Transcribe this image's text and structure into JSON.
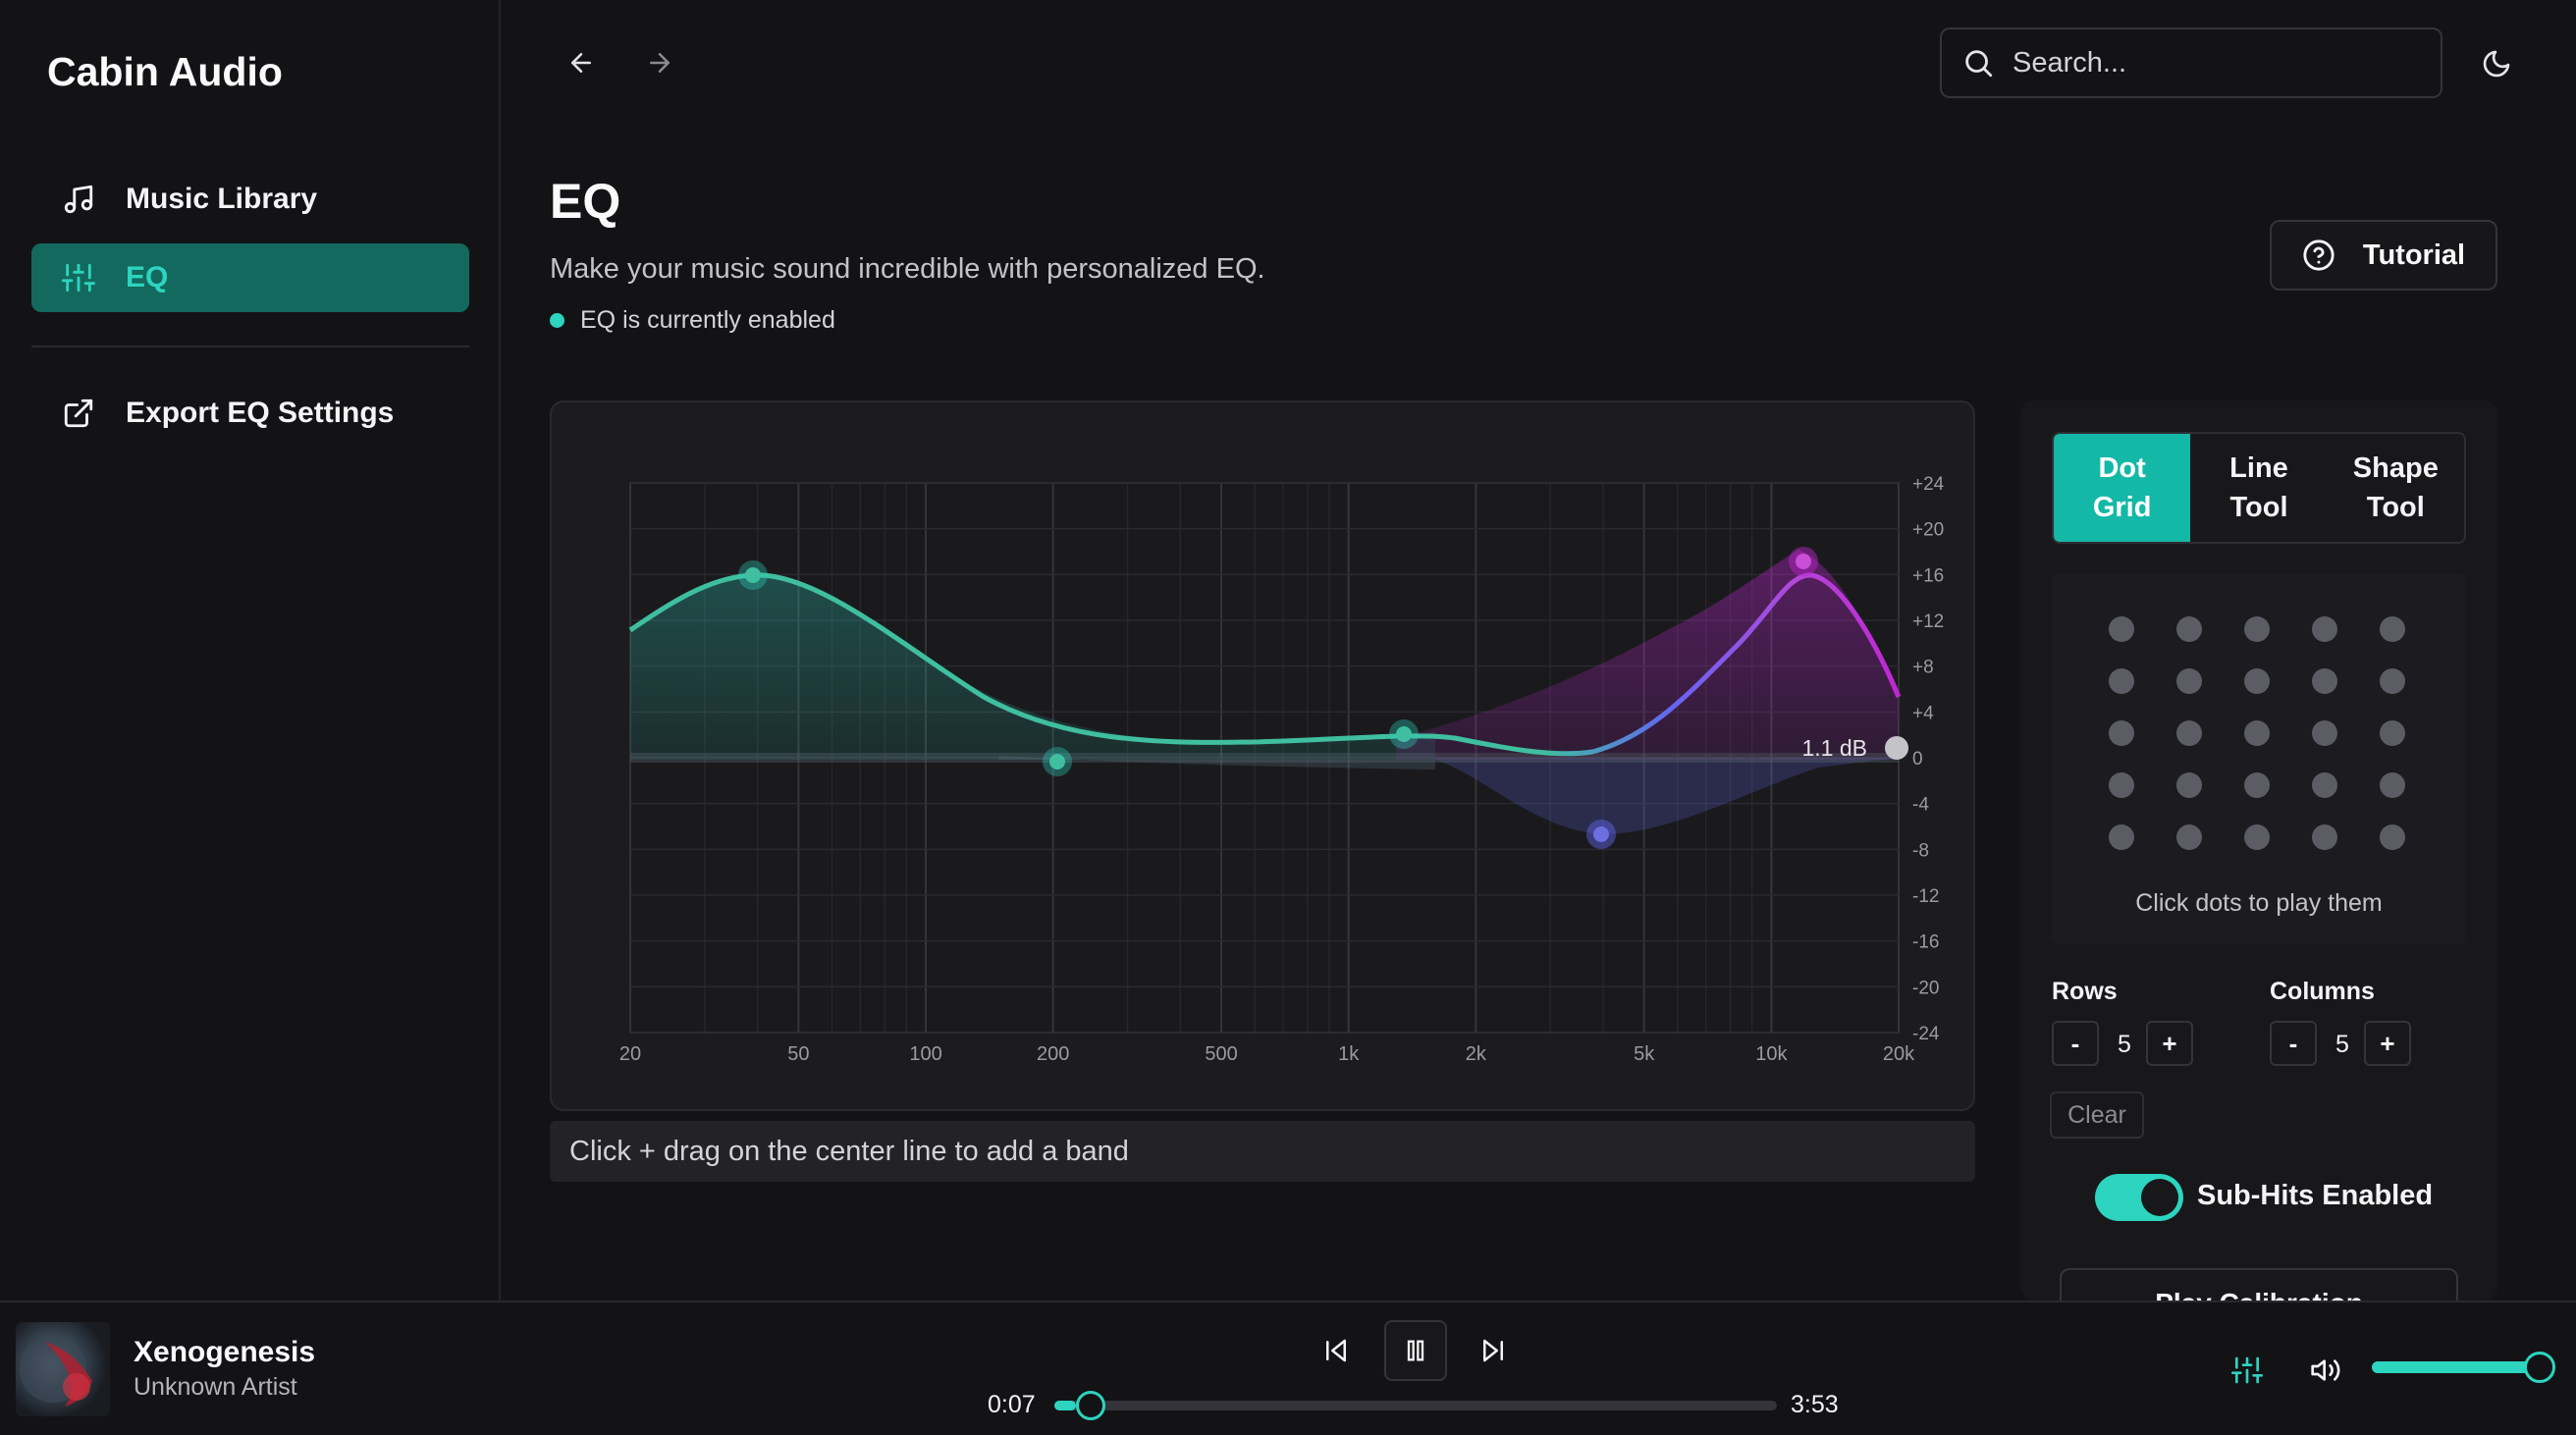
{
  "app": {
    "title": "Cabin Audio"
  },
  "sidebar": {
    "items": [
      {
        "label": "Music Library",
        "icon": "music-note-icon",
        "active": false
      },
      {
        "label": "EQ",
        "icon": "sliders-icon",
        "active": true
      },
      {
        "label": "Export EQ Settings",
        "icon": "external-link-icon",
        "active": false
      }
    ]
  },
  "topbar": {
    "search_placeholder": "Search..."
  },
  "header": {
    "title": "EQ",
    "subtitle": "Make your music sound incredible with personalized EQ.",
    "status": "EQ is currently enabled",
    "tutorial_label": "Tutorial"
  },
  "eq": {
    "y_ticks": [
      "+24",
      "+20",
      "+16",
      "+12",
      "+8",
      "+4",
      "0",
      "-4",
      "-8",
      "-12",
      "-16",
      "-20",
      "-24"
    ],
    "x_ticks": [
      "20",
      "50",
      "100",
      "200",
      "500",
      "1k",
      "2k",
      "5k",
      "10k",
      "20k"
    ],
    "gain_readout": "1.1 dB",
    "hint": "Click + drag on the center line to add a band"
  },
  "tools": {
    "tabs": [
      "Dot\nGrid",
      "Line\nTool",
      "Shape\nTool"
    ],
    "active_tab": 0,
    "dot_hint": "Click dots to play them",
    "rows_label": "Rows",
    "rows_value": "5",
    "columns_label": "Columns",
    "columns_value": "5",
    "minus": "-",
    "plus": "+",
    "clear_label": "Clear",
    "subhits_label": "Sub-Hits Enabled",
    "subhits_enabled": true,
    "calibration_label": "Play Calibration"
  },
  "player": {
    "title": "Xenogenesis",
    "artist": "Unknown Artist",
    "current_time": "0:07",
    "total_time": "3:53",
    "progress": 0.03,
    "volume": 0.95
  },
  "colors": {
    "accent": "#2dd4bf",
    "accent_dark": "#13695e",
    "magenta": "#c026d3",
    "indigo": "#6366f1"
  }
}
